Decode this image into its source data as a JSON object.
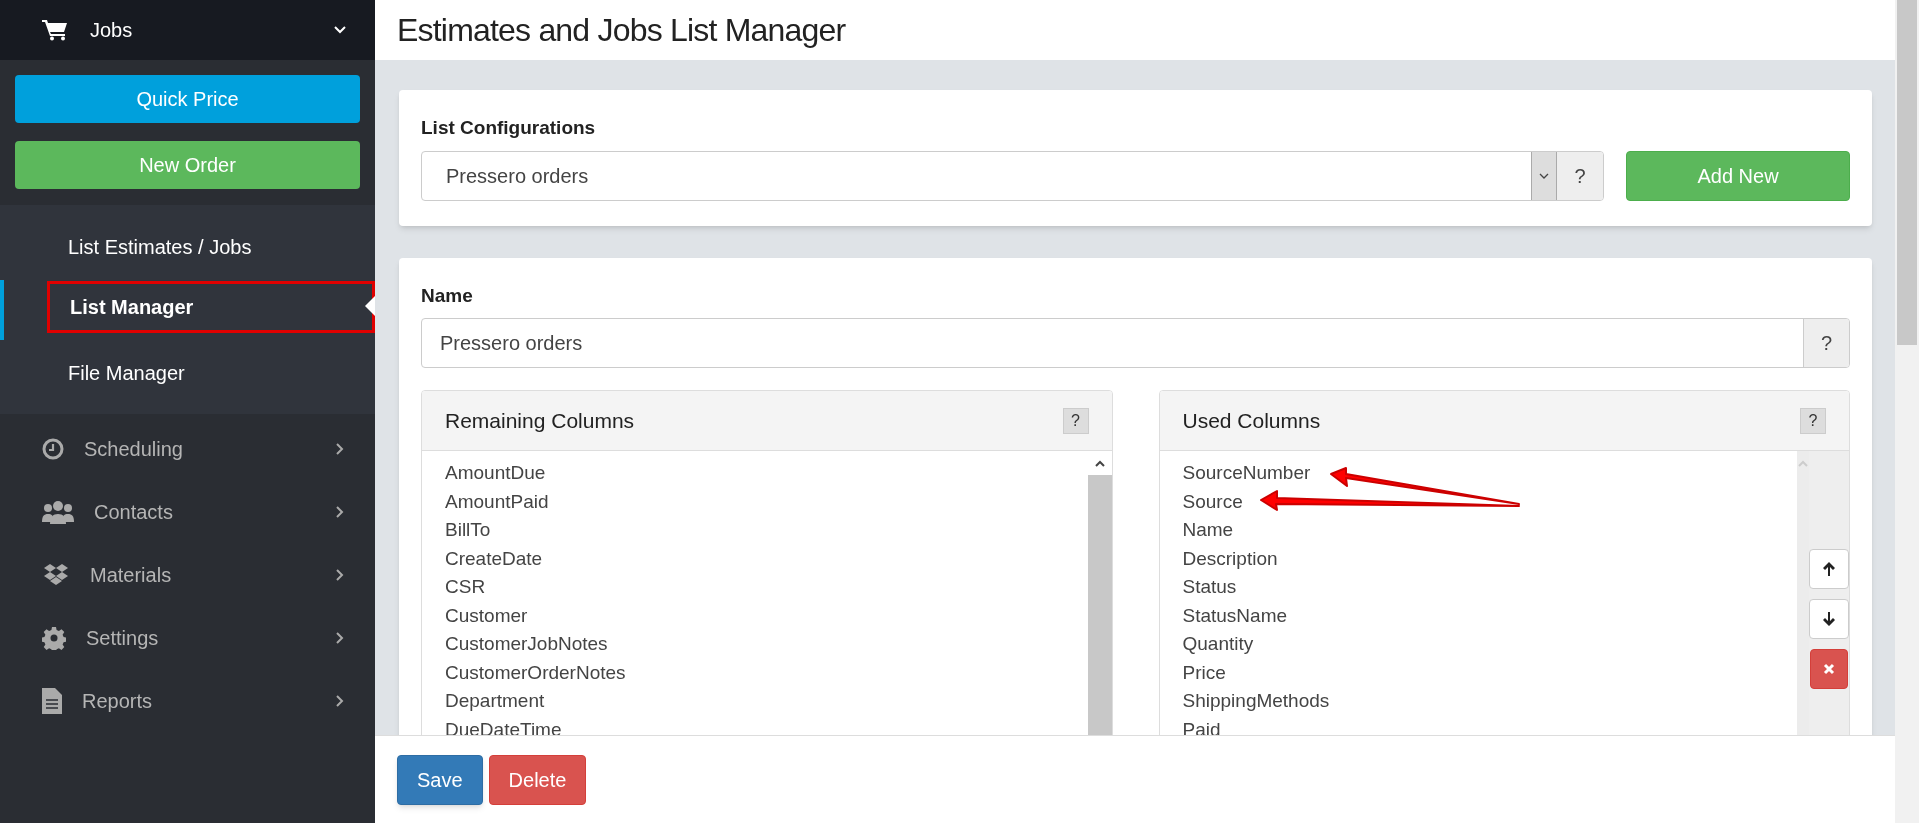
{
  "sidebar": {
    "section": {
      "label": "Jobs",
      "expanded": true
    },
    "actions": [
      {
        "label": "Quick Price",
        "kind": "info"
      },
      {
        "label": "New Order",
        "kind": "success"
      }
    ],
    "subitems": [
      {
        "label": "List Estimates / Jobs",
        "selected": false
      },
      {
        "label": "List Manager",
        "selected": true
      },
      {
        "label": "File Manager",
        "selected": false
      }
    ],
    "menu": [
      {
        "label": "Scheduling"
      },
      {
        "label": "Contacts"
      },
      {
        "label": "Materials"
      },
      {
        "label": "Settings"
      },
      {
        "label": "Reports"
      }
    ]
  },
  "page_title": "Estimates and Jobs List Manager",
  "list_configurations": {
    "label": "List Configurations",
    "value": "Pressero orders",
    "help": "?",
    "add_button": "Add New"
  },
  "name_field": {
    "label": "Name",
    "value": "Pressero orders",
    "help": "?"
  },
  "remaining_columns": {
    "title": "Remaining Columns",
    "help": "?",
    "items": [
      "AmountDue",
      "AmountPaid",
      "BillTo",
      "CreateDate",
      "CSR",
      "Customer",
      "CustomerJobNotes",
      "CustomerOrderNotes",
      "Department",
      "DueDateTime"
    ]
  },
  "used_columns": {
    "title": "Used Columns",
    "help": "?",
    "items": [
      "SourceNumber",
      "Source",
      "Name",
      "Description",
      "Status",
      "StatusName",
      "Quantity",
      "Price",
      "ShippingMethods",
      "Paid"
    ]
  },
  "footer_buttons": [
    {
      "label": "Save",
      "kind": "primary"
    },
    {
      "label": "Delete",
      "kind": "danger"
    }
  ]
}
